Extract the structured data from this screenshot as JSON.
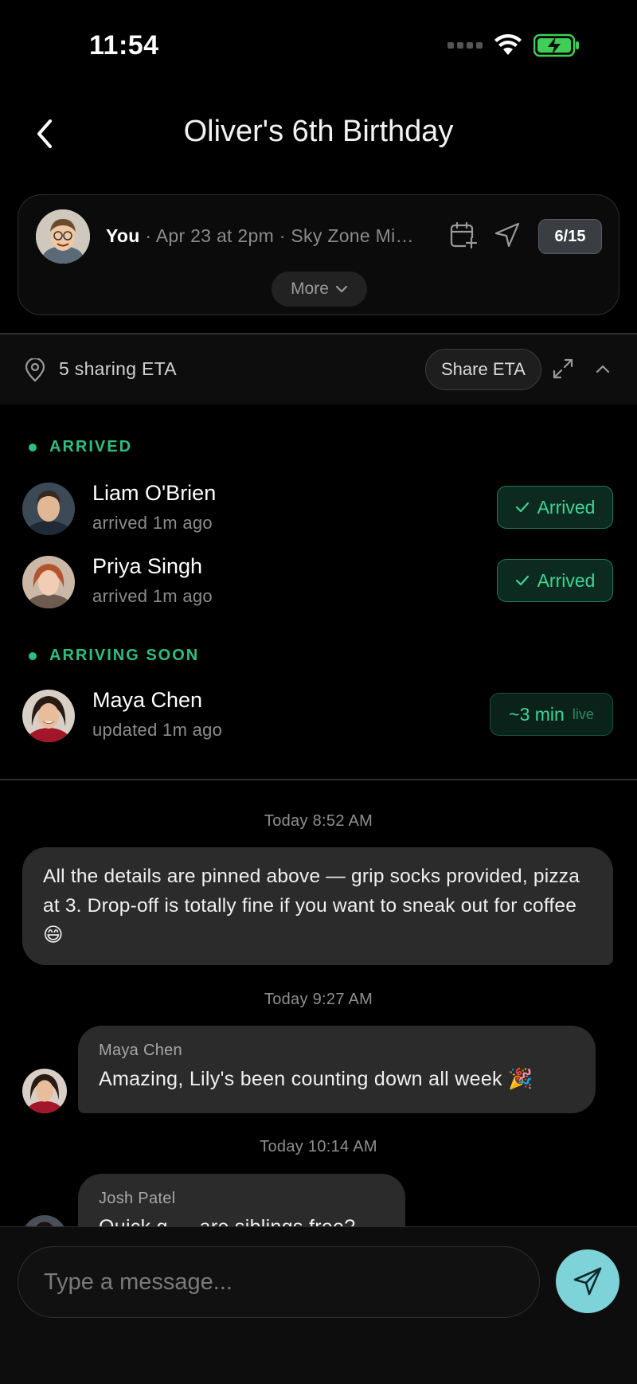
{
  "status_bar": {
    "time": "11:54"
  },
  "header": {
    "title": "Oliver's 6th Birthday"
  },
  "event": {
    "host": "You",
    "details": " · Apr 23 at 2pm · Sky Zone Miss...",
    "rsvp_count": "6/15",
    "more_label": "More"
  },
  "eta_bar": {
    "sharing_text": "5 sharing ETA",
    "share_button": "Share ETA"
  },
  "sections": {
    "arrived": {
      "label": "ARRIVED",
      "people": [
        {
          "name": "Liam O'Brien",
          "sub": "arrived 1m ago",
          "status": "Arrived"
        },
        {
          "name": "Priya Singh",
          "sub": "arrived 1m ago",
          "status": "Arrived"
        }
      ]
    },
    "arriving_soon": {
      "label": "ARRIVING SOON",
      "people": [
        {
          "name": "Maya Chen",
          "sub": "updated 1m ago",
          "eta": "~3 min",
          "eta_tag": "live"
        }
      ]
    }
  },
  "messages": [
    {
      "timestamp": "Today 8:52 AM",
      "sender": "",
      "text": "All the details are pinned above — grip socks provided, pizza at 3. Drop-off is totally fine if you want to sneak out for coffee 😄"
    },
    {
      "timestamp": "Today 9:27 AM",
      "sender": "Maya Chen",
      "text": "Amazing, Lily's been counting down all week 🎉"
    },
    {
      "timestamp": "Today 10:14 AM",
      "sender": "Josh Patel",
      "text": "Quick q — are siblings free?"
    }
  ],
  "composer": {
    "placeholder": "Type a message..."
  },
  "colors": {
    "accent_green": "#2dbf80",
    "send_button": "#7dd3d8",
    "bubble": "#2b2b2b",
    "battery_green": "#3fcf54"
  }
}
